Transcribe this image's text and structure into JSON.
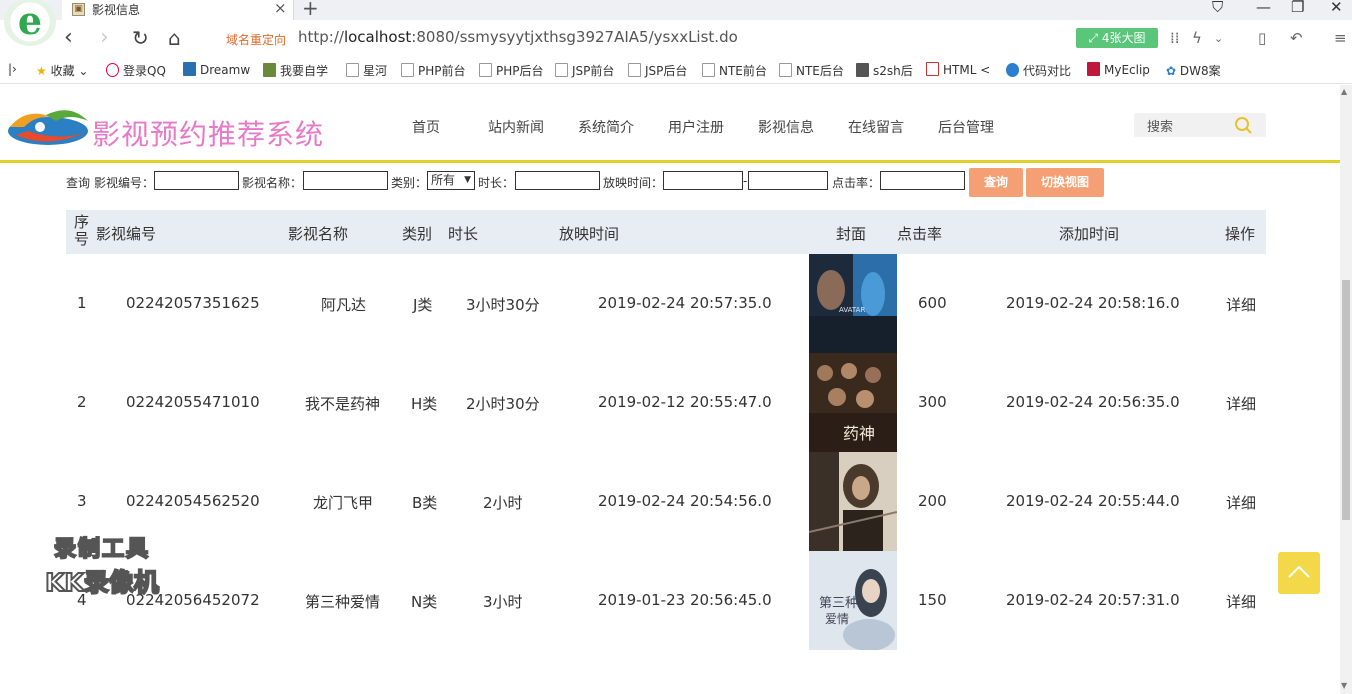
{
  "browser": {
    "logo_letter": "e",
    "tab_title": "影视信息",
    "redirect_label": "域名重定向",
    "url_prefix": "http://",
    "url_host": "localhost",
    "url_rest": ":8080/ssmysyytjxthsg3927AIA5/ysxxList.do",
    "bigpic_label": "4张大图",
    "bookmarks": [
      "收藏",
      "登录QQ",
      "Dreamw",
      "我要自学",
      "星河",
      "PHP前台",
      "PHP后台",
      "JSP前台",
      "JSP后台",
      "NTE前台",
      "NTE后台",
      "s2sh后",
      "HTML <",
      "代码对比",
      "MyEclip",
      "DW8案"
    ]
  },
  "site": {
    "title": "影视预约推荐系统",
    "nav": [
      "首页",
      "站内新闻",
      "系统简介",
      "用户注册",
      "影视信息",
      "在线留言",
      "后台管理"
    ],
    "search_label": "搜索"
  },
  "filter": {
    "query_label": "查询",
    "code_label": "影视编号：",
    "name_label": "影视名称：",
    "category_label": "类别：",
    "category_value": "所有",
    "duration_label": "时长：",
    "showtime_label": "放映时间：",
    "range_sep": "-",
    "clicks_label": "点击率：",
    "search_button": "查询",
    "switch_button": "切换视图"
  },
  "table": {
    "headers": {
      "seq": "序号",
      "code": "影视编号",
      "name": "影视名称",
      "category": "类别",
      "duration": "时长",
      "showtime": "放映时间",
      "cover": "封面",
      "clicks": "点击率",
      "added": "添加时间",
      "action": "操作"
    },
    "rows": [
      {
        "seq": "1",
        "code": "02242057351625",
        "name": "阿凡达",
        "category": "J类",
        "duration": "3小时30分",
        "showtime": "2019-02-24 20:57:35.0",
        "clicks": "600",
        "added": "2019-02-24 20:58:16.0",
        "action": "详细"
      },
      {
        "seq": "2",
        "code": "02242055471010",
        "name": "我不是药神",
        "category": "H类",
        "duration": "2小时30分",
        "showtime": "2019-02-12 20:55:47.0",
        "clicks": "300",
        "added": "2019-02-24 20:56:35.0",
        "action": "详细"
      },
      {
        "seq": "3",
        "code": "02242054562520",
        "name": "龙门飞甲",
        "category": "B类",
        "duration": "2小时",
        "showtime": "2019-02-24 20:54:56.0",
        "clicks": "200",
        "added": "2019-02-24 20:55:44.0",
        "action": "详细"
      },
      {
        "seq": "4",
        "code": "02242056452072",
        "name": "第三种爱情",
        "category": "N类",
        "duration": "3小时",
        "showtime": "2019-01-23 20:56:45.0",
        "clicks": "150",
        "added": "2019-02-24 20:57:31.0",
        "action": "详细"
      }
    ]
  },
  "overlay": {
    "watermark_line1": "录制工具",
    "watermark_line2": "KK录像机"
  },
  "colors": {
    "title_pink": "#e879c8",
    "header_rule": "#e0d12a",
    "button_orange": "#f5a074",
    "table_head_bg": "#e8ecf3",
    "backtop_yellow": "#f3d84a"
  }
}
